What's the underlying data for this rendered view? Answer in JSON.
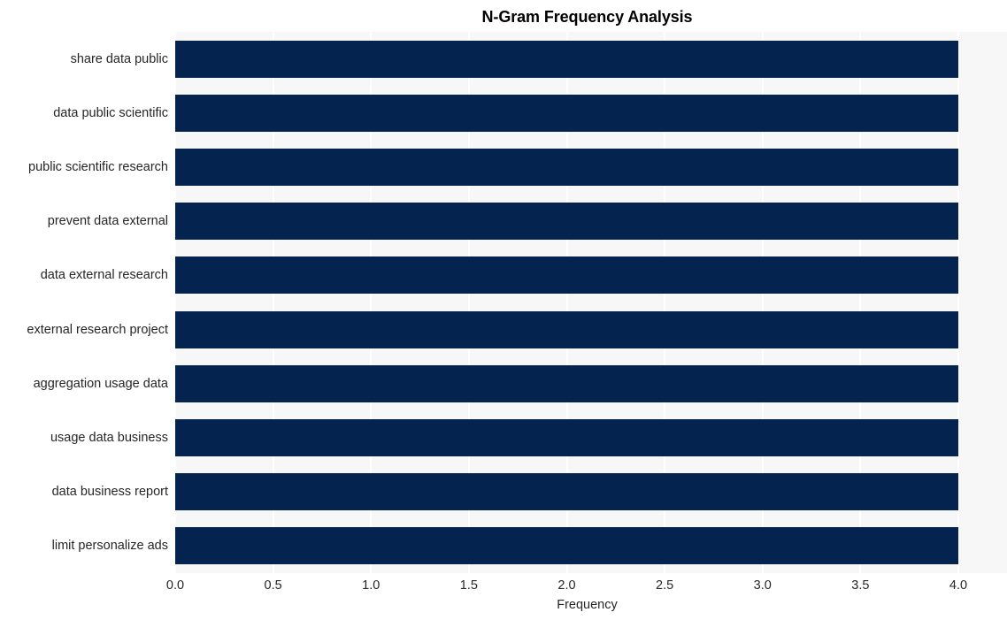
{
  "chart_data": {
    "type": "bar",
    "orientation": "horizontal",
    "title": "N-Gram Frequency Analysis",
    "xlabel": "Frequency",
    "ylabel": "",
    "categories": [
      "share data public",
      "data public scientific",
      "public scientific research",
      "prevent data external",
      "data external research",
      "external research project",
      "aggregation usage data",
      "usage data business",
      "data business report",
      "limit personalize ads"
    ],
    "values": [
      4,
      4,
      4,
      4,
      4,
      4,
      4,
      4,
      4,
      4
    ],
    "xlim": [
      0.0,
      4.0
    ],
    "xticks": [
      "0.0",
      "0.5",
      "1.0",
      "1.5",
      "2.0",
      "2.5",
      "3.0",
      "3.5",
      "4.0"
    ],
    "xtick_values": [
      0.0,
      0.5,
      1.0,
      1.5,
      2.0,
      2.5,
      3.0,
      3.5,
      4.0
    ],
    "grid": true,
    "grid_axis": "x",
    "legend": null,
    "bar_color": "#04244f",
    "plot_background": "#f7f7f7",
    "grid_color": "#ffffff",
    "text_color": "#262626",
    "title_color": "#000000"
  }
}
